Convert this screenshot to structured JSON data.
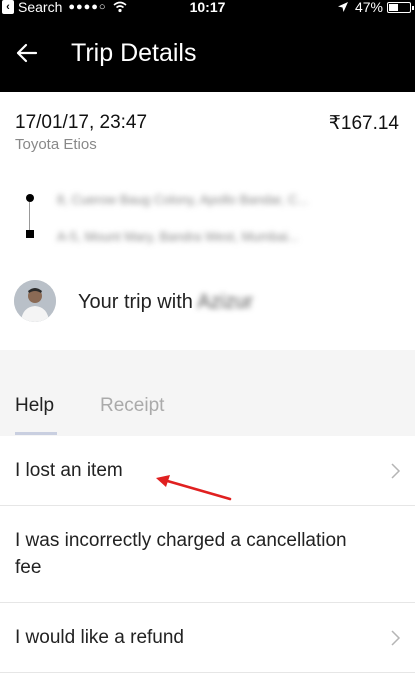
{
  "status_bar": {
    "back_app": "Search",
    "signal": "●●●●○",
    "time": "10:17",
    "battery": "47%",
    "battery_level": 0.47
  },
  "header": {
    "title": "Trip Details",
    "back_icon": "arrow-left-icon"
  },
  "trip": {
    "datetime": "17/01/17, 23:47",
    "fare": "₹167.14",
    "vehicle": "Toyota Etios",
    "pickup": "8, Cuerow Baug Colony, Apollo Bandar, C...",
    "dropoff": "A-5, Mount Mary, Bandra West, Mumbai..."
  },
  "driver": {
    "label": "Your trip with",
    "name": "Azizur"
  },
  "tabs": [
    {
      "label": "Help",
      "active": true
    },
    {
      "label": "Receipt",
      "active": false
    }
  ],
  "help_items": [
    {
      "label": "I lost an item",
      "icon": "chevron-right-icon"
    },
    {
      "label": "I was incorrectly charged a cancellation fee",
      "icon": "chevron-right-icon"
    },
    {
      "label": "I would like a refund",
      "icon": "chevron-right-icon"
    }
  ],
  "colors": {
    "header_bg": "#000000",
    "annotation_arrow": "#e02020",
    "muted_text": "#888888",
    "tab_underline": "#c9cfe0"
  }
}
